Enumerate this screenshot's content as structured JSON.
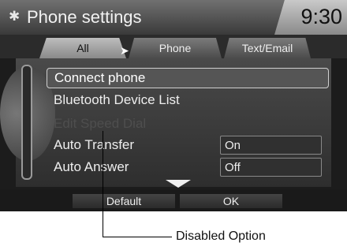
{
  "header": {
    "title": "Phone settings",
    "time": "9:30",
    "icon": "gear-icon"
  },
  "tabs": [
    {
      "label": "All",
      "active": true
    },
    {
      "label": "Phone",
      "active": false
    },
    {
      "label": "Text/Email",
      "active": false
    }
  ],
  "menu": {
    "items": [
      {
        "label": "Connect phone",
        "selected": true
      },
      {
        "label": "Bluetooth Device List"
      },
      {
        "label": "Edit Speed Dial",
        "disabled": true
      },
      {
        "label": "Auto Transfer",
        "value": "On"
      },
      {
        "label": "Auto Answer",
        "value": "Off"
      }
    ]
  },
  "buttons": {
    "default_label": "Default",
    "ok_label": "OK"
  },
  "callout": {
    "label": "Disabled Option"
  },
  "colors": {
    "screen_bg": "#1c1c1c",
    "selected_border": "#d0d0d0",
    "disabled_text": "#4e4e4e"
  }
}
